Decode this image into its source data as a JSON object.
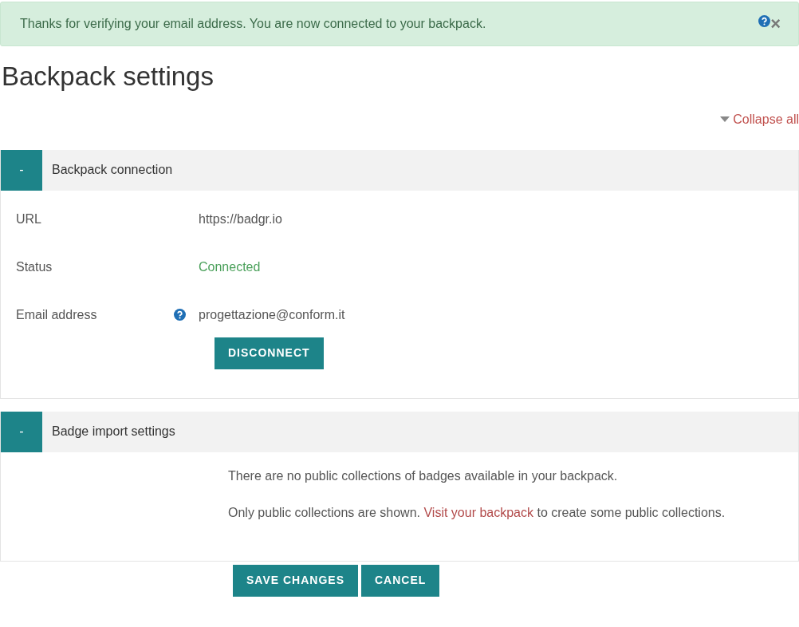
{
  "alert": {
    "message": "Thanks for verifying your email address. You are now connected to your backpack.",
    "help": true,
    "close": "×"
  },
  "title": "Backpack settings",
  "collapse_all": "Collapse all",
  "sections": [
    {
      "title": "Backpack connection",
      "expanded": true,
      "toggle": "-",
      "kind": "fields",
      "fields": [
        {
          "label": "URL",
          "value": "https://badgr.io",
          "help": false,
          "kind": "text"
        },
        {
          "label": "Status",
          "value": "Connected",
          "help": false,
          "kind": "status"
        },
        {
          "label": "Email address",
          "value": "progettazione@conform.it",
          "help": true,
          "kind": "text"
        }
      ],
      "button": "DISCONNECT"
    },
    {
      "title": "Badge import settings",
      "expanded": true,
      "toggle": "-",
      "kind": "notes",
      "notes": [
        {
          "text": "There are no public collections of badges available in your backpack."
        },
        {
          "before": "Only public collections are shown. ",
          "link": "Visit your backpack",
          "after": " to create some public collections."
        }
      ]
    }
  ],
  "buttons": [
    {
      "label": "SAVE CHANGES"
    },
    {
      "label": "CANCEL"
    }
  ]
}
